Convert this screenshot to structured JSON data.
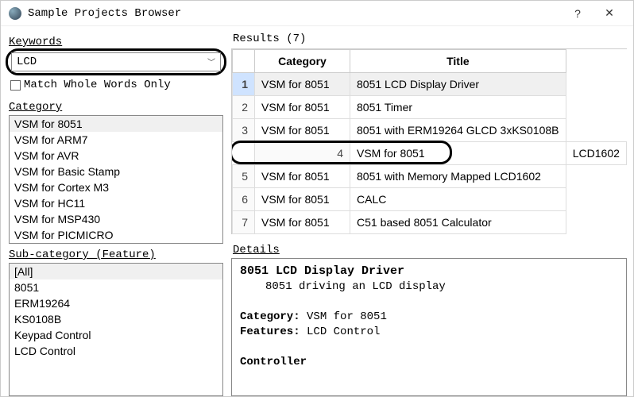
{
  "window": {
    "title": "Sample Projects Browser",
    "help_label": "?",
    "close_label": "✕"
  },
  "left": {
    "keywords_label": "Keywords",
    "keywords_value": "LCD",
    "match_whole_label": "Match Whole Words Only",
    "category_label": "Category",
    "categories": [
      "VSM for 8051",
      "VSM for ARM7",
      "VSM for AVR",
      "VSM for Basic Stamp",
      "VSM for Cortex M3",
      "VSM for HC11",
      "VSM for MSP430",
      "VSM for PICMICRO"
    ],
    "category_selected": "VSM for 8051",
    "subcategory_label": "Sub-category (Feature)",
    "subcategories": [
      "[All]",
      "8051",
      "ERM19264",
      "KS0108B",
      "Keypad Control",
      "LCD Control"
    ],
    "subcategory_selected": "[All]"
  },
  "results": {
    "header_label": "Results (7)",
    "col_category": "Category",
    "col_title": "Title",
    "rows": [
      {
        "n": "1",
        "category": "VSM for 8051",
        "title": "8051 LCD Display Driver"
      },
      {
        "n": "2",
        "category": "VSM for 8051",
        "title": "8051 Timer"
      },
      {
        "n": "3",
        "category": "VSM for 8051",
        "title": "8051 with ERM19264 GLCD 3xKS0108B"
      },
      {
        "n": "4",
        "category": "VSM for 8051",
        "title": "LCD1602"
      },
      {
        "n": "5",
        "category": "VSM for 8051",
        "title": "8051 with Memory Mapped LCD1602"
      },
      {
        "n": "6",
        "category": "VSM for 8051",
        "title": "CALC"
      },
      {
        "n": "7",
        "category": "VSM for 8051",
        "title": "C51 based 8051 Calculator"
      }
    ],
    "selected_row": "1",
    "annotated_row": "4"
  },
  "details": {
    "label": "Details",
    "title": "8051 LCD Display Driver",
    "subtitle": "8051 driving an LCD display",
    "category_key": "Category:",
    "category_val": "VSM for 8051",
    "features_key": "Features:",
    "features_val": "LCD Control",
    "controller_key": "Controller"
  }
}
